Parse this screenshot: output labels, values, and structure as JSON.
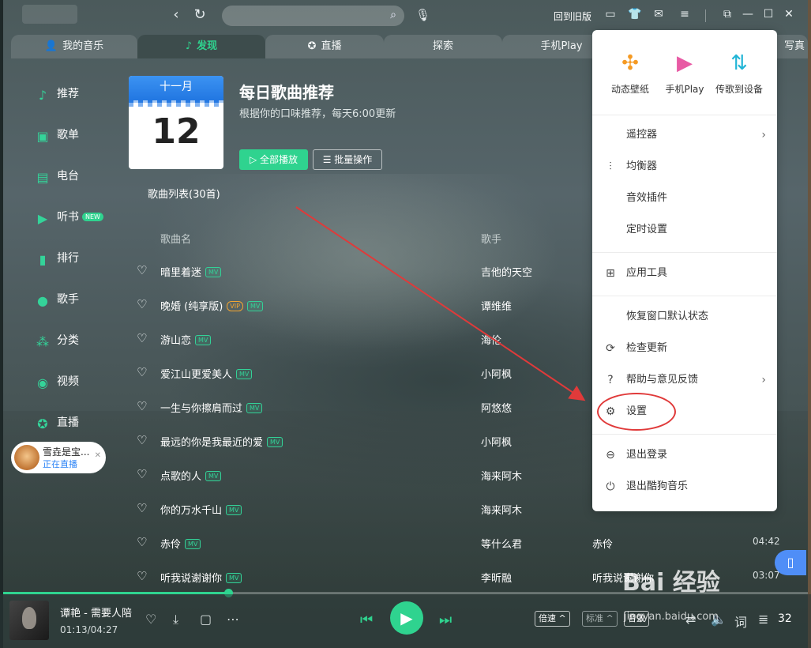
{
  "titlebar": {
    "back_to_old": "回到旧版",
    "icons": [
      "back-icon",
      "refresh-icon",
      "search-icon",
      "mic-icon",
      "monitor-icon",
      "shirt-icon",
      "mail-icon",
      "menu-icon",
      "minimode-icon",
      "minimize-icon",
      "maximize-icon",
      "close-icon"
    ]
  },
  "tabs": [
    {
      "label": "我的音乐",
      "icon": "user-icon"
    },
    {
      "label": "发现",
      "icon": "note-icon"
    },
    {
      "label": "直播",
      "icon": "star-circle-icon"
    },
    {
      "label": "探索"
    },
    {
      "label": "手机Play"
    },
    {
      "label": "写真"
    }
  ],
  "sidebar": {
    "items": [
      {
        "label": "推荐"
      },
      {
        "label": "歌单"
      },
      {
        "label": "电台"
      },
      {
        "label": "听书",
        "badge": "NEW"
      },
      {
        "label": "排行"
      },
      {
        "label": "歌手"
      },
      {
        "label": "分类"
      },
      {
        "label": "视频"
      },
      {
        "label": "直播"
      }
    ],
    "live_card": {
      "name": "雪垚是宝...",
      "status": "正在直播"
    }
  },
  "daily": {
    "calendar_month": "十一月",
    "calendar_day": "12",
    "title": "每日歌曲推荐",
    "subtitle": "根据你的口味推荐，每天6:00更新",
    "play_all": "全部播放",
    "batch": "批量操作",
    "list_count": "歌曲列表(30首)"
  },
  "table": {
    "headers": {
      "song": "歌曲名",
      "singer": "歌手"
    },
    "mv_label": "MV",
    "vip_label": "VIP",
    "rows": [
      {
        "title": "暗里着迷",
        "vip": false,
        "singer": "吉他的天空",
        "album": "",
        "duration": ""
      },
      {
        "title": "晚婚 (纯享版)",
        "vip": true,
        "singer": "谭维维",
        "album": "",
        "duration": ""
      },
      {
        "title": "游山恋",
        "vip": false,
        "singer": "海伦",
        "album": "",
        "duration": ""
      },
      {
        "title": "爱江山更爱美人",
        "vip": false,
        "singer": "小阿枫",
        "album": "",
        "duration": ""
      },
      {
        "title": "一生与你擦肩而过",
        "vip": false,
        "singer": "阿悠悠",
        "album": "",
        "duration": ""
      },
      {
        "title": "最远的你是我最近的爱",
        "vip": false,
        "singer": "小阿枫",
        "album": "",
        "duration": ""
      },
      {
        "title": "点歌的人",
        "vip": false,
        "singer": "海来阿木",
        "album": "",
        "duration": ""
      },
      {
        "title": "你的万水千山",
        "vip": false,
        "singer": "海来阿木",
        "album": "",
        "duration": ""
      },
      {
        "title": "赤伶",
        "vip": false,
        "singer": "等什么君",
        "album": "赤伶",
        "duration": "04:42"
      },
      {
        "title": "听我说谢谢你",
        "vip": false,
        "singer": "李昕融",
        "album": "听我说谢谢你",
        "duration": "03:07"
      }
    ]
  },
  "menu": {
    "top": [
      {
        "label": "动态壁纸",
        "icon": "pinwheel-icon",
        "color": "#f59a23"
      },
      {
        "label": "手机Play",
        "icon": "phone-play-icon",
        "color": "#e85aa4"
      },
      {
        "label": "传歌到设备",
        "icon": "transfer-icon",
        "color": "#21b5d6"
      }
    ],
    "items": [
      {
        "label": "遥控器",
        "icon": "",
        "arrow": true
      },
      {
        "label": "均衡器",
        "icon": "equalizer-icon",
        "arrow": false
      },
      {
        "label": "音效插件",
        "icon": "",
        "arrow": false
      },
      {
        "label": "定时设置",
        "icon": "",
        "arrow": false
      },
      {
        "label": "应用工具",
        "icon": "apps-icon",
        "arrow": false
      },
      {
        "label": "恢复窗口默认状态",
        "icon": "",
        "arrow": false
      },
      {
        "label": "检查更新",
        "icon": "update-icon",
        "arrow": false
      },
      {
        "label": "帮助与意见反馈",
        "icon": "help-icon",
        "arrow": true
      },
      {
        "label": "设置",
        "icon": "gear-icon",
        "arrow": false
      },
      {
        "label": "退出登录",
        "icon": "user-exit-icon",
        "arrow": false
      },
      {
        "label": "退出酷狗音乐",
        "icon": "power-icon",
        "arrow": false
      }
    ]
  },
  "player": {
    "now_playing": "谭艳 - 需要人陪",
    "time": "01:13/04:27",
    "progress": 0.28,
    "speed": "倍速",
    "quality": "标准",
    "sound": "音效",
    "playlist_count": "32"
  },
  "watermark": {
    "text": "Bai 经验",
    "url": "jingyan.baidu.com"
  },
  "colors": {
    "accent": "#2fd38f",
    "annotation_red": "#e03a3a",
    "calendar_blue": "#2a7de6"
  }
}
